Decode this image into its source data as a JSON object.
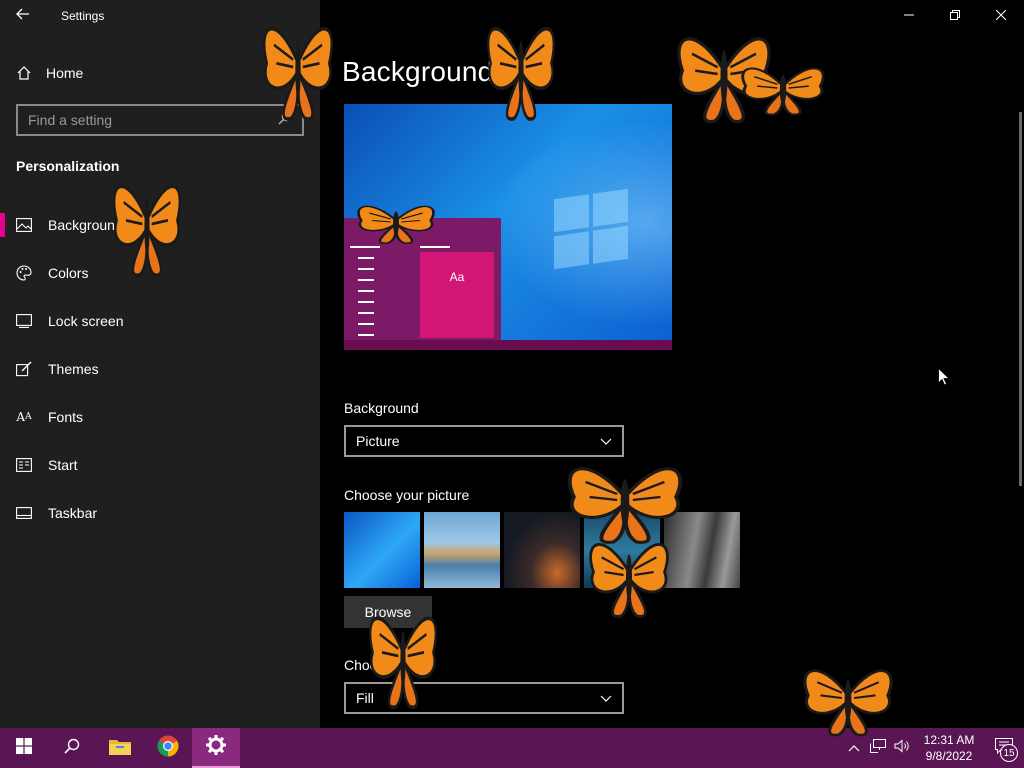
{
  "window": {
    "title": "Settings",
    "controls": {
      "minimize": "minimize",
      "restore": "restore",
      "close": "close"
    }
  },
  "sidebar": {
    "home_label": "Home",
    "search_placeholder": "Find a setting",
    "section_title": "Personalization",
    "items": [
      {
        "label": "Background",
        "icon": "image-icon",
        "selected": true
      },
      {
        "label": "Colors",
        "icon": "palette-icon",
        "selected": false
      },
      {
        "label": "Lock screen",
        "icon": "lock-screen-icon",
        "selected": false
      },
      {
        "label": "Themes",
        "icon": "themes-icon",
        "selected": false
      },
      {
        "label": "Fonts",
        "icon": "fonts-icon",
        "selected": false
      },
      {
        "label": "Start",
        "icon": "start-icon",
        "selected": false
      },
      {
        "label": "Taskbar",
        "icon": "taskbar-icon",
        "selected": false
      }
    ]
  },
  "main": {
    "page_title": "Background",
    "preview": {
      "sample_text": "Aa"
    },
    "background_label": "Background",
    "background_value": "Picture",
    "choose_picture_label": "Choose your picture",
    "browse_label": "Browse",
    "choose_fit_label": "Choose a fit",
    "fit_value": "Fill"
  },
  "taskbar": {
    "apps": [
      "start-icon",
      "search-icon",
      "file-explorer-icon",
      "chrome-icon",
      "settings-icon"
    ],
    "active_app": "settings-icon",
    "time": "12:31 AM",
    "date": "9/8/2022",
    "notification_count": "15"
  },
  "colors": {
    "accent": "#e3008c",
    "taskbar": "#5a1554",
    "sidebar": "#1f1f1f"
  }
}
